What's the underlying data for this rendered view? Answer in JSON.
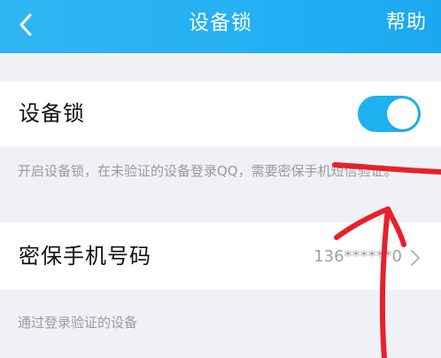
{
  "header": {
    "title": "设备锁",
    "help_label": "帮助"
  },
  "device_lock": {
    "label": "设备锁",
    "enabled": true,
    "description": "开启设备锁，在未验证的设备登录QQ，需要密保手机短信验证。"
  },
  "security_phone": {
    "label": "密保手机号码",
    "value": "136******0"
  },
  "devices_section": {
    "label": "通过登录验证的设备"
  },
  "colors": {
    "header_blue": "#23b0f2",
    "toggle_on": "#1fb1ef",
    "annotation_red": "#e8202a"
  },
  "icons": {
    "back": "chevron-left-icon",
    "row_arrow": "chevron-right-icon"
  }
}
